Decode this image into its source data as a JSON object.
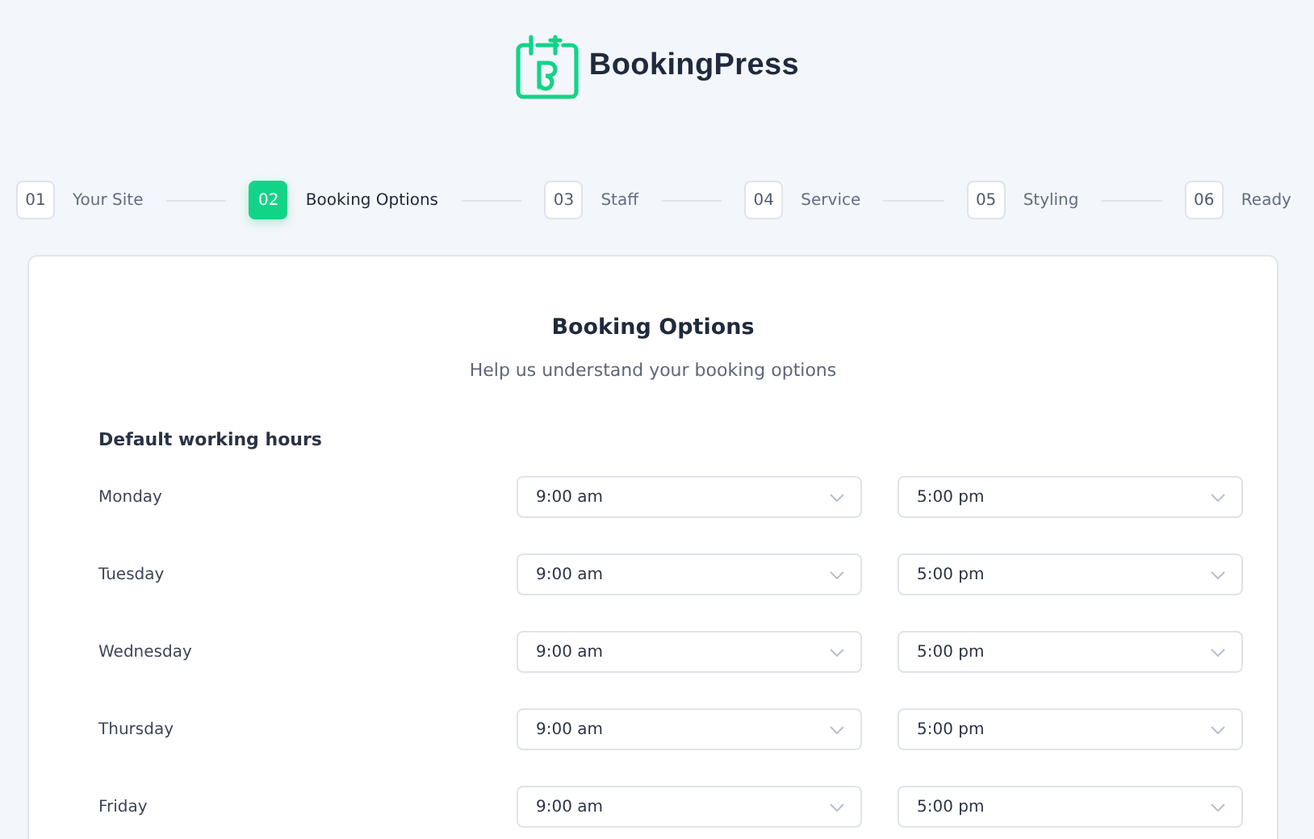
{
  "brand": {
    "name": "BookingPress"
  },
  "steps": [
    {
      "number": "01",
      "label": "Your Site",
      "selected": false
    },
    {
      "number": "02",
      "label": "Booking Options",
      "selected": true
    },
    {
      "number": "03",
      "label": "Staff",
      "selected": false
    },
    {
      "number": "04",
      "label": "Service",
      "selected": false
    },
    {
      "number": "05",
      "label": "Styling",
      "selected": false
    },
    {
      "number": "06",
      "label": "Ready",
      "selected": false
    }
  ],
  "card": {
    "title": "Booking Options",
    "subtitle": "Help us understand your booking options",
    "section_label": "Default working hours",
    "days": [
      {
        "day": "Monday",
        "start": "9:00 am",
        "end": "5:00 pm"
      },
      {
        "day": "Tuesday",
        "start": "9:00 am",
        "end": "5:00 pm"
      },
      {
        "day": "Wednesday",
        "start": "9:00 am",
        "end": "5:00 pm"
      },
      {
        "day": "Thursday",
        "start": "9:00 am",
        "end": "5:00 pm"
      },
      {
        "day": "Friday",
        "start": "9:00 am",
        "end": "5:00 pm"
      }
    ]
  }
}
